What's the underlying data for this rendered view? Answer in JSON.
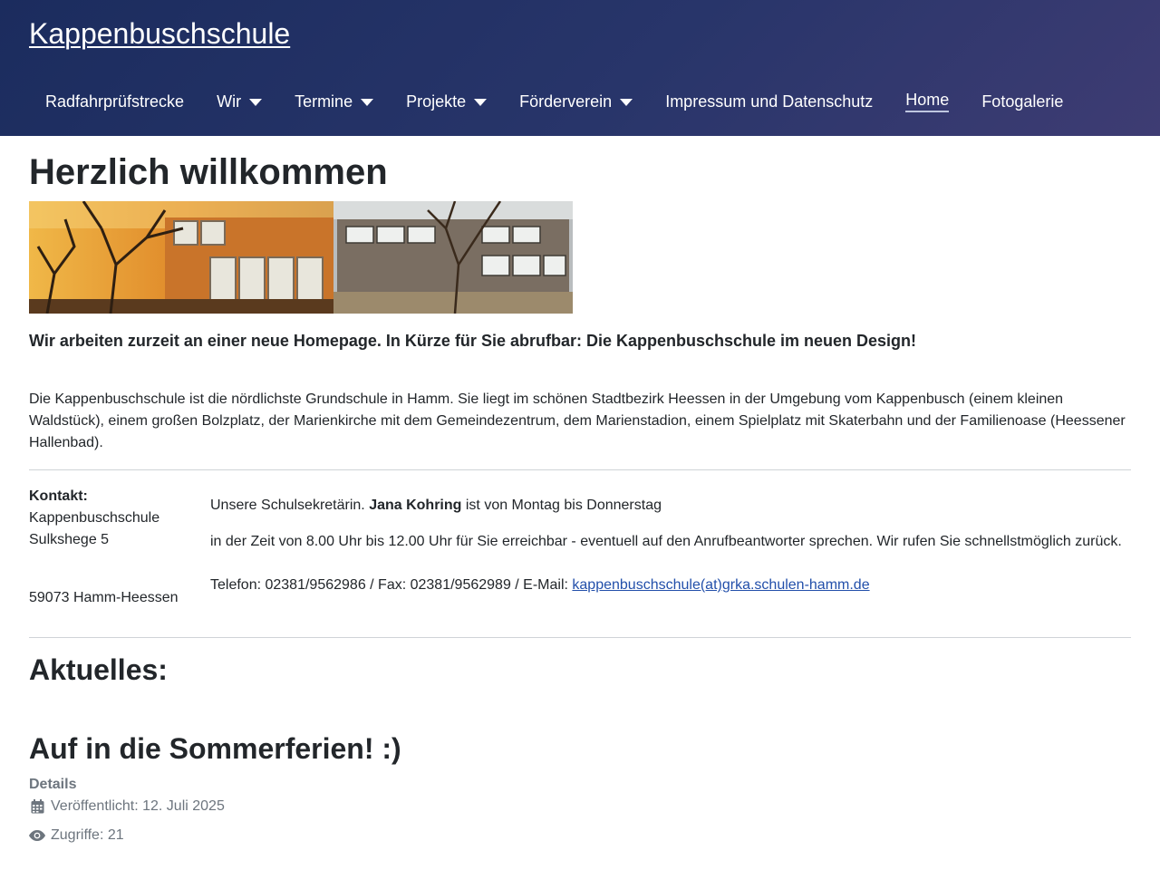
{
  "header": {
    "brand": "Kappenbuschschule",
    "nav": [
      {
        "label": "Radfahrprüfstrecke",
        "dropdown": false
      },
      {
        "label": "Wir",
        "dropdown": true
      },
      {
        "label": "Termine",
        "dropdown": true
      },
      {
        "label": "Projekte",
        "dropdown": true
      },
      {
        "label": "Förderverein",
        "dropdown": true
      },
      {
        "label": "Impressum und Datenschutz",
        "dropdown": false
      },
      {
        "label": "Home",
        "dropdown": false,
        "active": true
      },
      {
        "label": "Fotogalerie",
        "dropdown": false
      }
    ]
  },
  "main": {
    "title": "Herzlich willkommen",
    "notice": "Wir arbeiten zurzeit an einer neue Homepage. In Kürze für Sie abrufbar: Die Kappenbuschschule im neuen Design!",
    "intro": "Die Kappenbuschschule ist die nördlichste Grundschule in Hamm. Sie liegt im schönen Stadtbezirk Heessen in der Umgebung vom Kappenbusch (einem kleinen Waldstück), einem großen Bolzplatz, der Marienkirche mit dem Gemeindezentrum, dem Marienstadion, einem Spielplatz mit Skaterbahn und der Familienoase (Heessener Hallenbad).",
    "contact": {
      "heading": "Kontakt:",
      "name": "Kappenbuschschule",
      "street": "Sulkshege 5",
      "city": "59073 Hamm-Heessen",
      "line1_pre": "Unsere Schulsekretärin. ",
      "line1_name": "Jana Kohring",
      "line1_post": " ist von Montag bis Donnerstag",
      "line2": "in der Zeit von 8.00 Uhr bis 12.00 Uhr für Sie erreichbar - eventuell auf den Anrufbeantworter sprechen. Wir rufen Sie schnellstmöglich zurück.",
      "line3_pre": "Telefon: 02381/9562986 / Fax: 02381/9562989 / E-Mail: ",
      "email": "kappenbuschschule(at)grka.schulen-hamm.de"
    },
    "news_heading": "Aktuelles:",
    "article": {
      "title": "Auf in die Sommerferien! :)",
      "details_label": "Details",
      "published": "Veröffentlicht: 12. Juli 2025",
      "hits": "Zugriffe: 21"
    }
  },
  "colors": {
    "header_bg": "#1b2c5e",
    "link": "#224faa",
    "meta_text": "#6d757e"
  },
  "icons": [
    "calendar-icon",
    "eye-icon",
    "caret-down-icon"
  ]
}
